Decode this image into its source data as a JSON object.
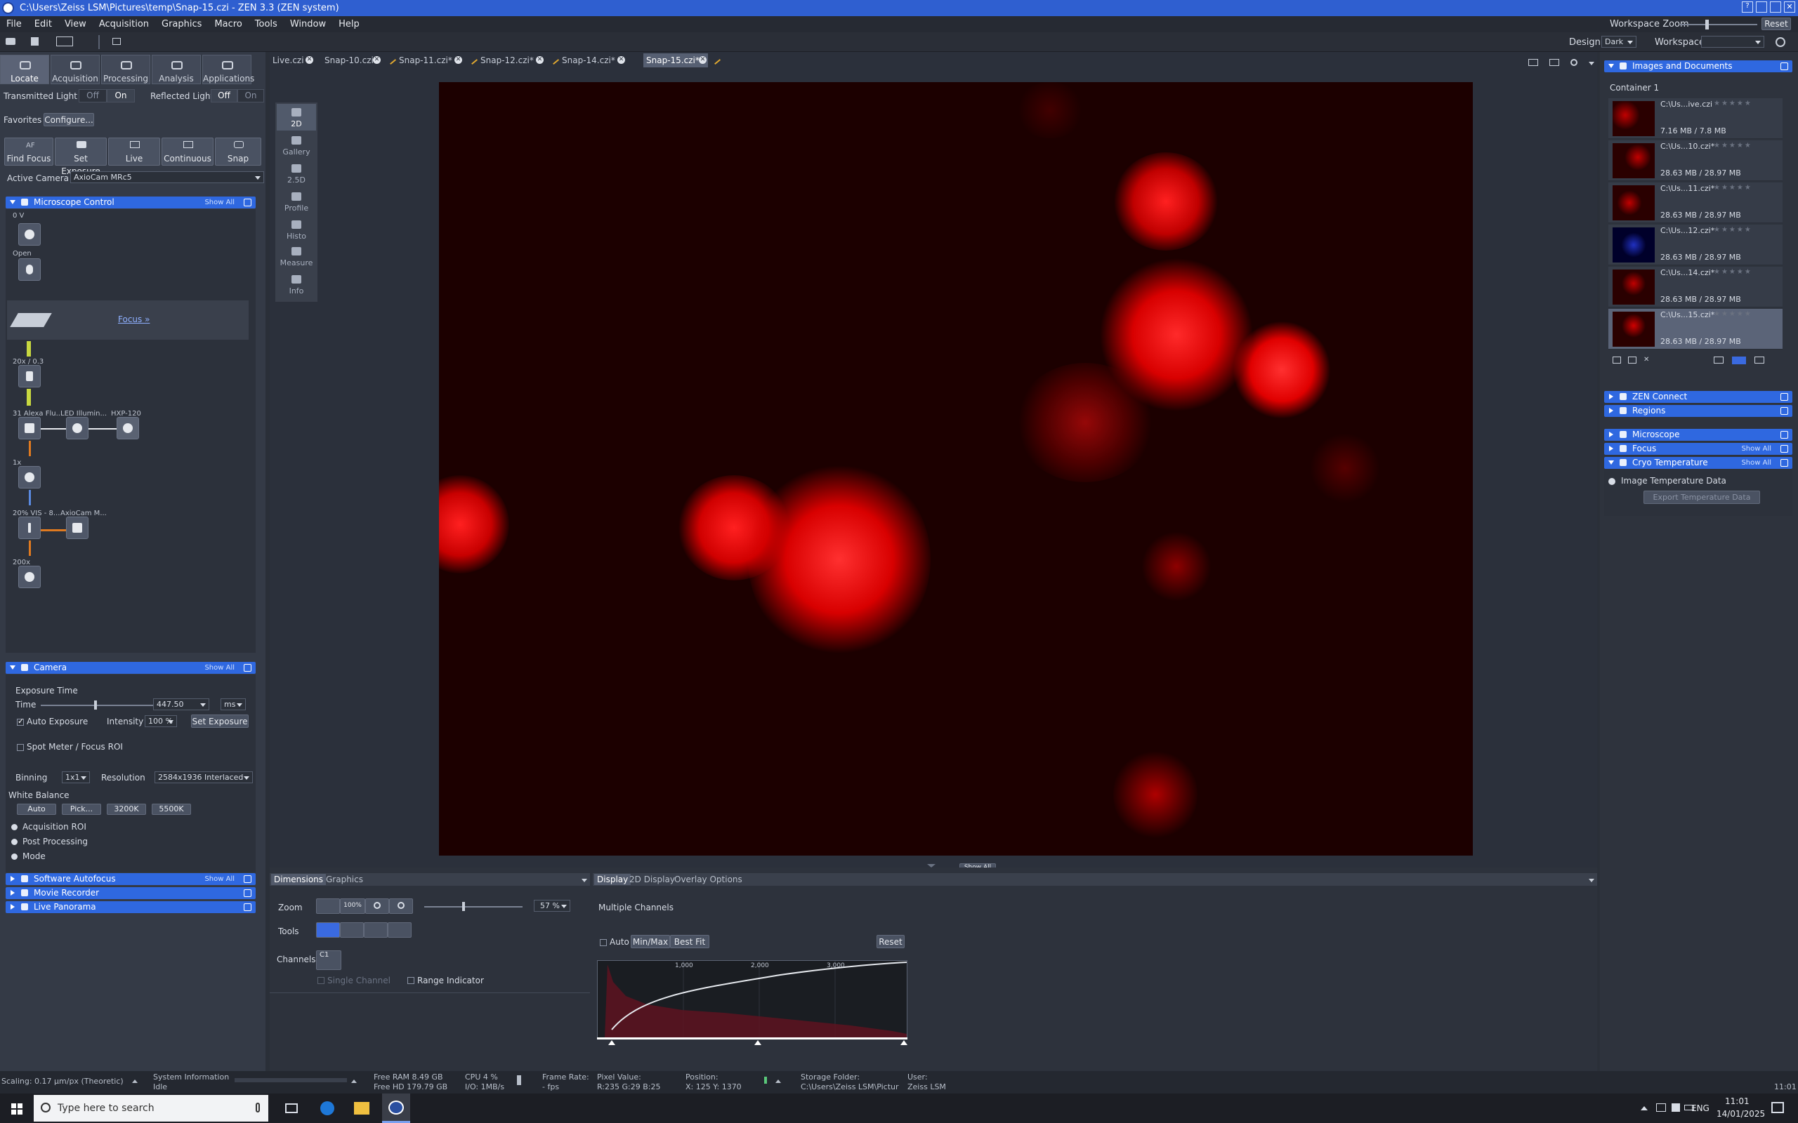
{
  "window": {
    "title": "C:\\Users\\Zeiss LSM\\Pictures\\temp\\Snap-15.czi - ZEN 3.3 (ZEN system)"
  },
  "menu": [
    "File",
    "Edit",
    "View",
    "Acquisition",
    "Graphics",
    "Macro",
    "Tools",
    "Window",
    "Help"
  ],
  "topright": {
    "workspace_zoom": "Workspace Zoom",
    "reset": "Reset",
    "design_label": "Design",
    "design_value": "Dark",
    "workspace_label": "Workspace"
  },
  "main_tabs": [
    "Locate",
    "Acquisition",
    "Processing",
    "Analysis",
    "Applications"
  ],
  "light": {
    "transmitted": "Transmitted Light",
    "reflected": "Reflected Light",
    "off": "Off",
    "on": "On"
  },
  "favorites": {
    "label": "Favorites",
    "configure": "Configure..."
  },
  "actions": [
    {
      "top": "AF",
      "label": "Find Focus"
    },
    {
      "top": "",
      "label": "Set Exposure"
    },
    {
      "top": "",
      "label": "Live"
    },
    {
      "top": "",
      "label": "Continuous"
    },
    {
      "top": "",
      "label": "Snap"
    }
  ],
  "active_camera": {
    "label": "Active Camera",
    "value": "AxioCam MRc5"
  },
  "sections": {
    "microscope_control": "Microscope Control",
    "camera": "Camera",
    "software_autofocus": "Software Autofocus",
    "movie_recorder": "Movie Recorder",
    "live_panorama": "Live Panorama",
    "show_all": "Show All"
  },
  "microscope": {
    "voltage": "0 V",
    "open": "Open",
    "focus": "Focus »",
    "objective": "20x / 0.3",
    "filter": "31 Alexa Flu...",
    "led": "LED Illumin...",
    "hxp": "HXP-120",
    "zoom1x": "1x",
    "vis": "20% VIS - 8...",
    "axiocam": "AxioCam M...",
    "mag": "200x"
  },
  "camera": {
    "exposure_time": "Exposure Time",
    "time": "Time",
    "time_value": "447.50",
    "unit": "ms",
    "auto_exposure": "Auto Exposure",
    "intensity": "Intensity",
    "intensity_value": "100 %",
    "set_exposure": "Set Exposure",
    "spot_meter": "Spot Meter / Focus ROI",
    "binning": "Binning",
    "binning_value": "1x1",
    "resolution": "Resolution",
    "resolution_value": "2584x1936 Interlaced",
    "white_balance": "White Balance",
    "wb_buttons": [
      "Auto",
      "Pick...",
      "3200K",
      "5500K"
    ],
    "acq_roi": "Acquisition ROI",
    "post_processing": "Post Processing",
    "mode": "Mode"
  },
  "doc_tabs": [
    "Live.czi",
    "Snap-10.czi*",
    "Snap-11.czi*",
    "Snap-12.czi*",
    "Snap-14.czi*",
    "Snap-15.czi*"
  ],
  "view_modes": [
    "2D",
    "Gallery",
    "2.5D",
    "Profile",
    "Histo",
    "Measure",
    "Info"
  ],
  "bottom": {
    "tab_dimensions": "Dimensions",
    "tab_graphics": "Graphics",
    "zoom_label": "Zoom",
    "zoom_value": "57 %",
    "tools_label": "Tools",
    "channels_label": "Channels",
    "channel_c1": "C1",
    "single_channel": "Single Channel",
    "range_indicator": "Range Indicator",
    "tab_display": "Display",
    "tab_2d_display": "2D Display",
    "tab_overlay": "Overlay Options",
    "multiple_channels": "Multiple Channels",
    "auto": "Auto",
    "minmax": "Min/Max",
    "bestfit": "Best Fit",
    "reset": "Reset",
    "show_all": "Show All",
    "hist_ticks": [
      "1,000",
      "2,000",
      "3,000"
    ]
  },
  "right": {
    "images_docs": "Images and Documents",
    "container": "Container 1",
    "files": [
      {
        "name": "C:\\Us...ive.czi",
        "size": "7.16 MB / 7.8 MB"
      },
      {
        "name": "C:\\Us...10.czi*",
        "size": "28.63 MB / 28.97 MB"
      },
      {
        "name": "C:\\Us...11.czi*",
        "size": "28.63 MB / 28.97 MB"
      },
      {
        "name": "C:\\Us...12.czi*",
        "size": "28.63 MB / 28.97 MB"
      },
      {
        "name": "C:\\Us...14.czi*",
        "size": "28.63 MB / 28.97 MB"
      },
      {
        "name": "C:\\Us...15.czi*",
        "size": "28.63 MB / 28.97 MB"
      }
    ],
    "zen_connect": "ZEN Connect",
    "regions": "Regions",
    "microscope": "Microscope",
    "focus": "Focus",
    "cryo": "Cryo Temperature",
    "image_temp": "Image Temperature Data",
    "export_temp": "Export Temperature Data",
    "show_all": "Show All"
  },
  "status": {
    "scaling": "Scaling:  0.17 µm/px (Theoretic)",
    "sysinfo": "System Information",
    "idle": "Idle",
    "free_ram": "Free RAM  8.49 GB",
    "free_hd": "Free HD    179.79 GB",
    "cpu": "CPU  4 %",
    "io": "I/O:   1MB/s",
    "frame_rate": "Frame Rate:",
    "fps": "- fps",
    "pixel_value": "Pixel Value:",
    "rgb": "R:235 G:29 B:25",
    "position": "Position:",
    "xy": "X: 125   Y: 1370",
    "storage": "Storage Folder:",
    "storage_path": "C:\\Users\\Zeiss LSM\\Pictur",
    "user": "User:",
    "user_name": "Zeiss LSM",
    "time": "11:01"
  },
  "taskbar": {
    "search": "Type here to search",
    "lang": "ENG",
    "time": "11:01",
    "date": "14/01/2025"
  }
}
